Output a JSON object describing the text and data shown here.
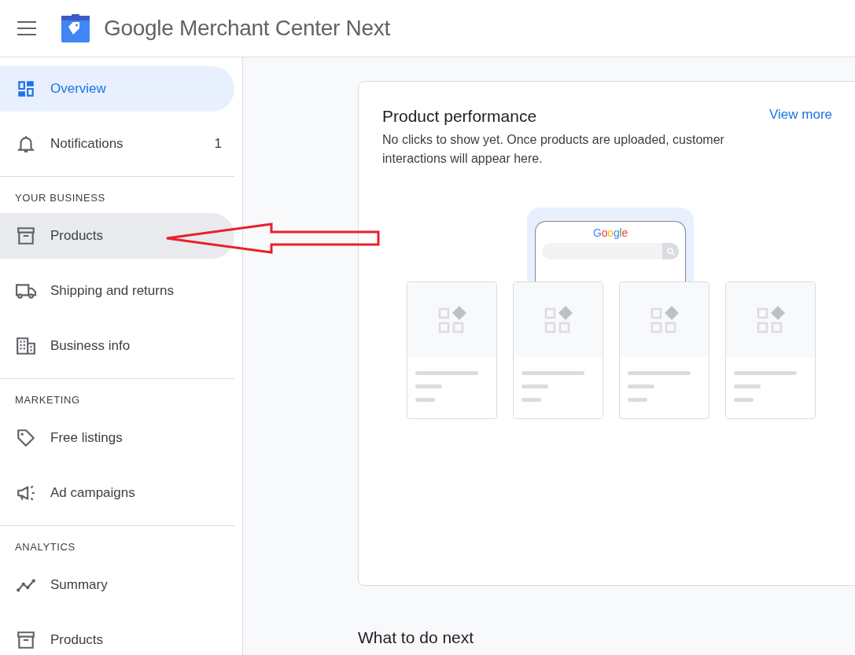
{
  "header": {
    "title_brand": "Google",
    "title_product": "Merchant Center Next"
  },
  "sidebar": {
    "sections": [
      {
        "items": [
          {
            "label": "Overview",
            "selected": true,
            "highlighted": false
          },
          {
            "label": "Notifications",
            "badge": "1",
            "selected": false,
            "highlighted": false
          }
        ]
      },
      {
        "heading": "YOUR BUSINESS",
        "items": [
          {
            "label": "Products",
            "selected": false,
            "highlighted": true
          },
          {
            "label": "Shipping and returns",
            "selected": false,
            "highlighted": false
          },
          {
            "label": "Business info",
            "selected": false,
            "highlighted": false
          }
        ]
      },
      {
        "heading": "MARKETING",
        "items": [
          {
            "label": "Free listings",
            "selected": false,
            "highlighted": false
          },
          {
            "label": "Ad campaigns",
            "selected": false,
            "highlighted": false
          }
        ]
      },
      {
        "heading": "ANALYTICS",
        "items": [
          {
            "label": "Summary",
            "selected": false,
            "highlighted": false
          },
          {
            "label": "Products",
            "selected": false,
            "highlighted": false
          }
        ]
      }
    ]
  },
  "performance_card": {
    "title": "Product performance",
    "link": "View more",
    "message": "No clicks to show yet. Once products are uploaded, customer interactions will appear here.",
    "illustration_logo": "Google"
  },
  "next_heading": "What to do next",
  "annotations": [
    {
      "kind": "arrow"
    }
  ]
}
